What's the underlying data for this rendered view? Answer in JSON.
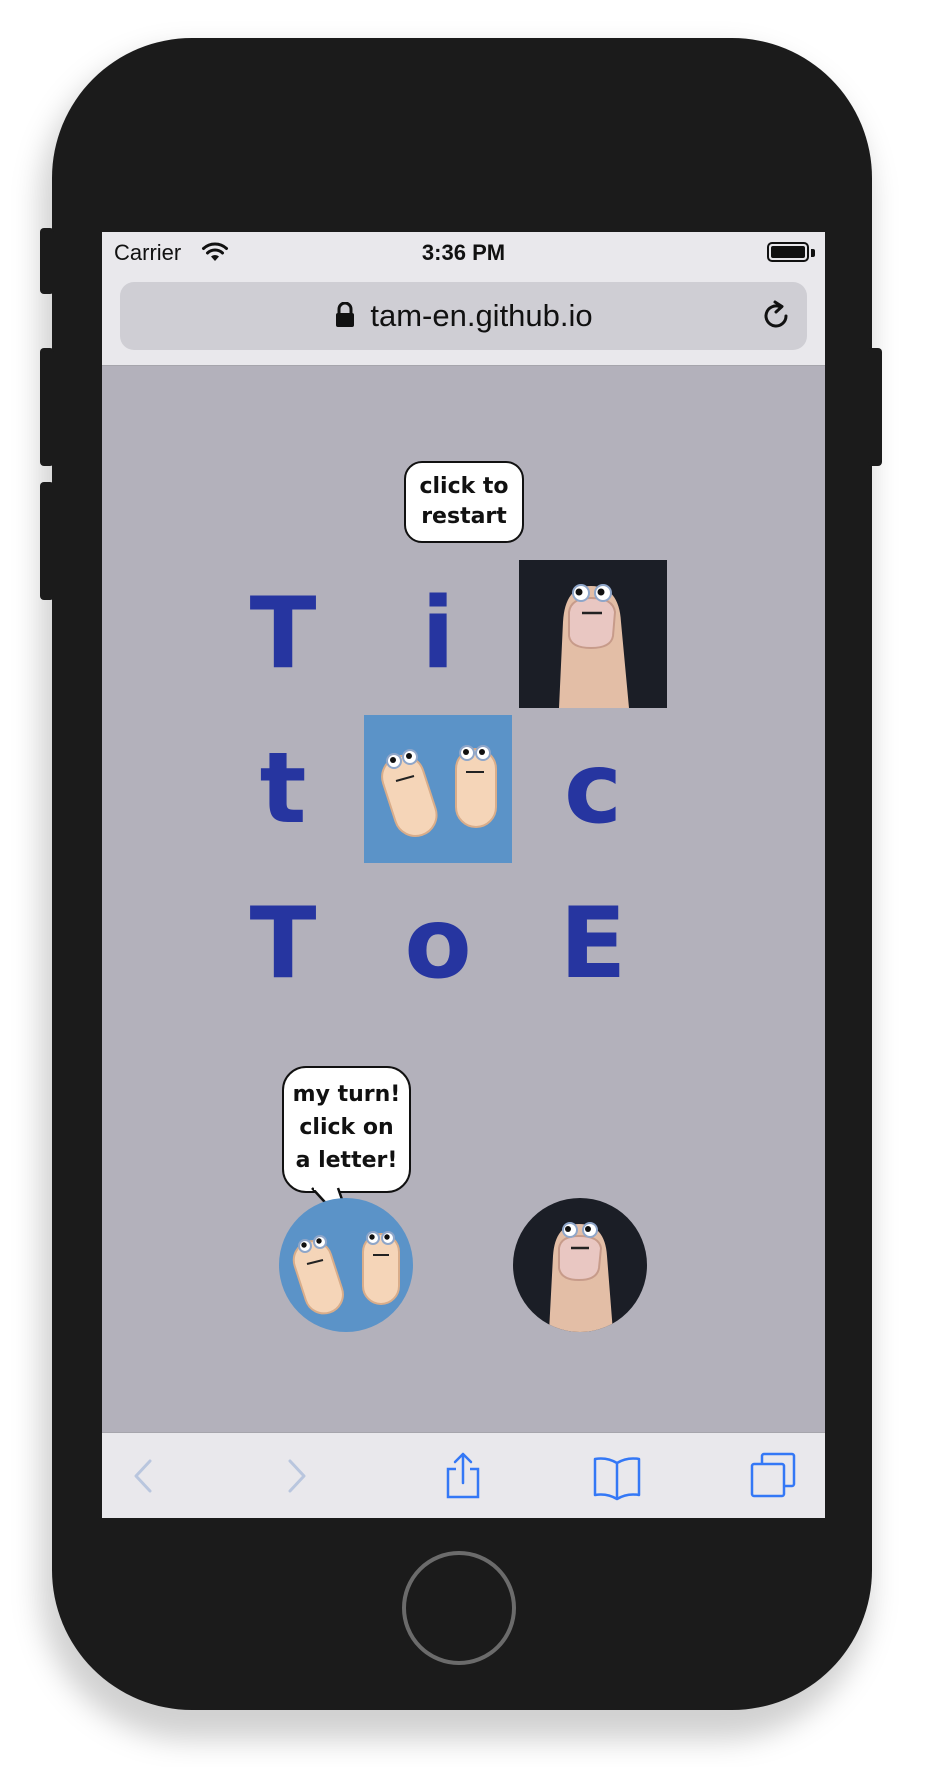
{
  "status_bar": {
    "carrier": "Carrier",
    "time": "3:36 PM"
  },
  "browser": {
    "url": "tam-en.github.io"
  },
  "game": {
    "restart_label_line1": "click to",
    "restart_label_line2": "restart",
    "turn_line1": "my turn!",
    "turn_line2": "click on",
    "turn_line3": "a letter!",
    "board": [
      {
        "row": 0,
        "col": 0,
        "letter": "T",
        "taken_by": null
      },
      {
        "row": 0,
        "col": 1,
        "letter": "i",
        "taken_by": null
      },
      {
        "row": 0,
        "col": 2,
        "letter": "",
        "taken_by": "thumb"
      },
      {
        "row": 1,
        "col": 0,
        "letter": "t",
        "taken_by": null
      },
      {
        "row": 1,
        "col": 1,
        "letter": "",
        "taken_by": "pills"
      },
      {
        "row": 1,
        "col": 2,
        "letter": "c",
        "taken_by": null
      },
      {
        "row": 2,
        "col": 0,
        "letter": "T",
        "taken_by": null
      },
      {
        "row": 2,
        "col": 1,
        "letter": "o",
        "taken_by": null
      },
      {
        "row": 2,
        "col": 2,
        "letter": "E",
        "taken_by": null
      }
    ],
    "players": [
      {
        "id": "pills",
        "icon": "googly-pills-icon",
        "active": true
      },
      {
        "id": "thumb",
        "icon": "googly-thumb-icon",
        "active": false
      }
    ]
  },
  "colors": {
    "letter": "#2635a0",
    "page_bg": "#b3b1bb",
    "toolbar_tint": "#3478f6"
  },
  "toolbar": {
    "icons": [
      "back-icon",
      "forward-icon",
      "share-icon",
      "bookmarks-icon",
      "tabs-icon"
    ]
  }
}
